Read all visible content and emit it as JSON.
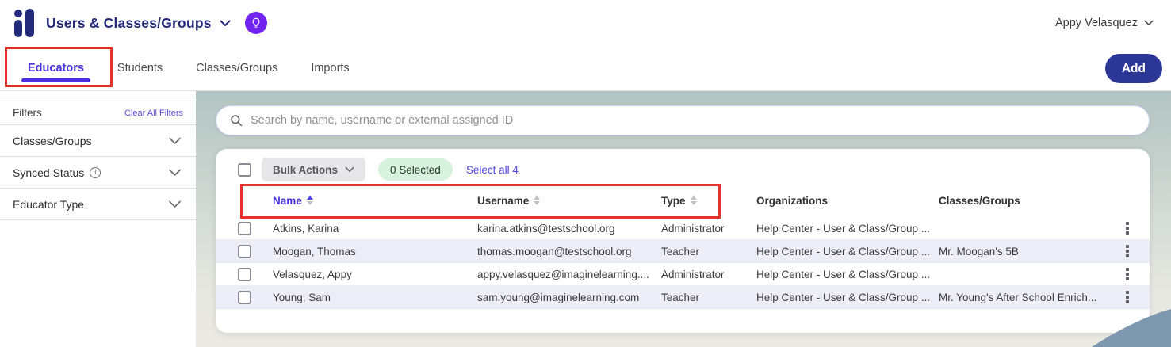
{
  "header": {
    "title": "Users & Classes/Groups",
    "user_name": "Appy Velasquez"
  },
  "tabs": [
    {
      "label": "Educators",
      "active": true
    },
    {
      "label": "Students",
      "active": false
    },
    {
      "label": "Classes/Groups",
      "active": false
    },
    {
      "label": "Imports",
      "active": false
    }
  ],
  "actions": {
    "add_label": "Add"
  },
  "sidebar": {
    "title": "Filters",
    "clear_all": "Clear All Filters",
    "sections": [
      {
        "label": "Classes/Groups",
        "has_info": false
      },
      {
        "label": "Synced Status",
        "has_info": true
      },
      {
        "label": "Educator Type",
        "has_info": false
      }
    ]
  },
  "search": {
    "placeholder": "Search by name, username or external assigned ID"
  },
  "toolbar": {
    "bulk_actions_label": "Bulk Actions",
    "selected_badge": "0 Selected",
    "select_all_label": "Select all 4"
  },
  "table": {
    "columns": [
      {
        "label": "Name",
        "sort": "asc"
      },
      {
        "label": "Username",
        "sort": "none"
      },
      {
        "label": "Type",
        "sort": "none"
      },
      {
        "label": "Organizations",
        "sort": null
      },
      {
        "label": "Classes/Groups",
        "sort": null
      }
    ],
    "rows": [
      {
        "name": "Atkins, Karina",
        "username": "karina.atkins@testschool.org",
        "type": "Administrator",
        "organizations": "Help Center - User & Class/Group ...",
        "classes": ""
      },
      {
        "name": "Moogan, Thomas",
        "username": "thomas.moogan@testschool.org",
        "type": "Teacher",
        "organizations": "Help Center - User & Class/Group ...",
        "classes": "Mr. Moogan's 5B"
      },
      {
        "name": "Velasquez, Appy",
        "username": "appy.velasquez@imaginelearning....",
        "type": "Administrator",
        "organizations": "Help Center - User & Class/Group ...",
        "classes": ""
      },
      {
        "name": "Young, Sam",
        "username": "sam.young@imaginelearning.com",
        "type": "Teacher",
        "organizations": "Help Center - User & Class/Group ...",
        "classes": "Mr. Young's After School Enrich..."
      }
    ]
  },
  "icons": {
    "logo": "imagine-learning-logo",
    "help": "lightbulb-icon",
    "search": "search-icon",
    "chevron": "chevron-down-icon",
    "info": "info-icon",
    "kebab": "kebab-menu-icon",
    "sort": "sort-arrows-icon"
  },
  "colors": {
    "brand_navy": "#232a7c",
    "accent_purple": "#4733d9",
    "add_button": "#2b3696",
    "help_button": "#7124f0",
    "link": "#4f46e5",
    "selected_badge_bg": "#d8f3dd",
    "row_alt": "#ededf8",
    "annotation_red": "#e5322b",
    "wave_blue": "#7e98b0"
  }
}
